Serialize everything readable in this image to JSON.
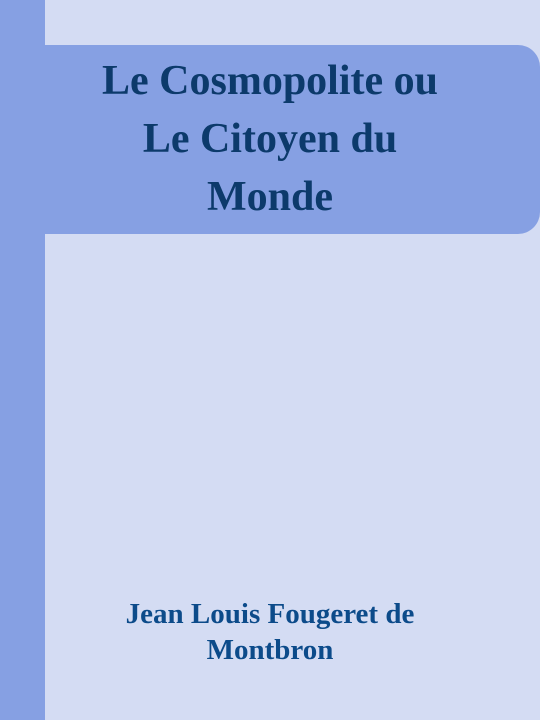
{
  "book": {
    "title": "Le Cosmopolite ou\nLe Citoyen du\nMonde",
    "author": "Jean Louis Fougeret de\nMontbron"
  },
  "colors": {
    "background": "#d4dcf3",
    "accent": "#86a0e3",
    "title_text": "#0c3a6b",
    "author_text": "#0c4b8a"
  }
}
